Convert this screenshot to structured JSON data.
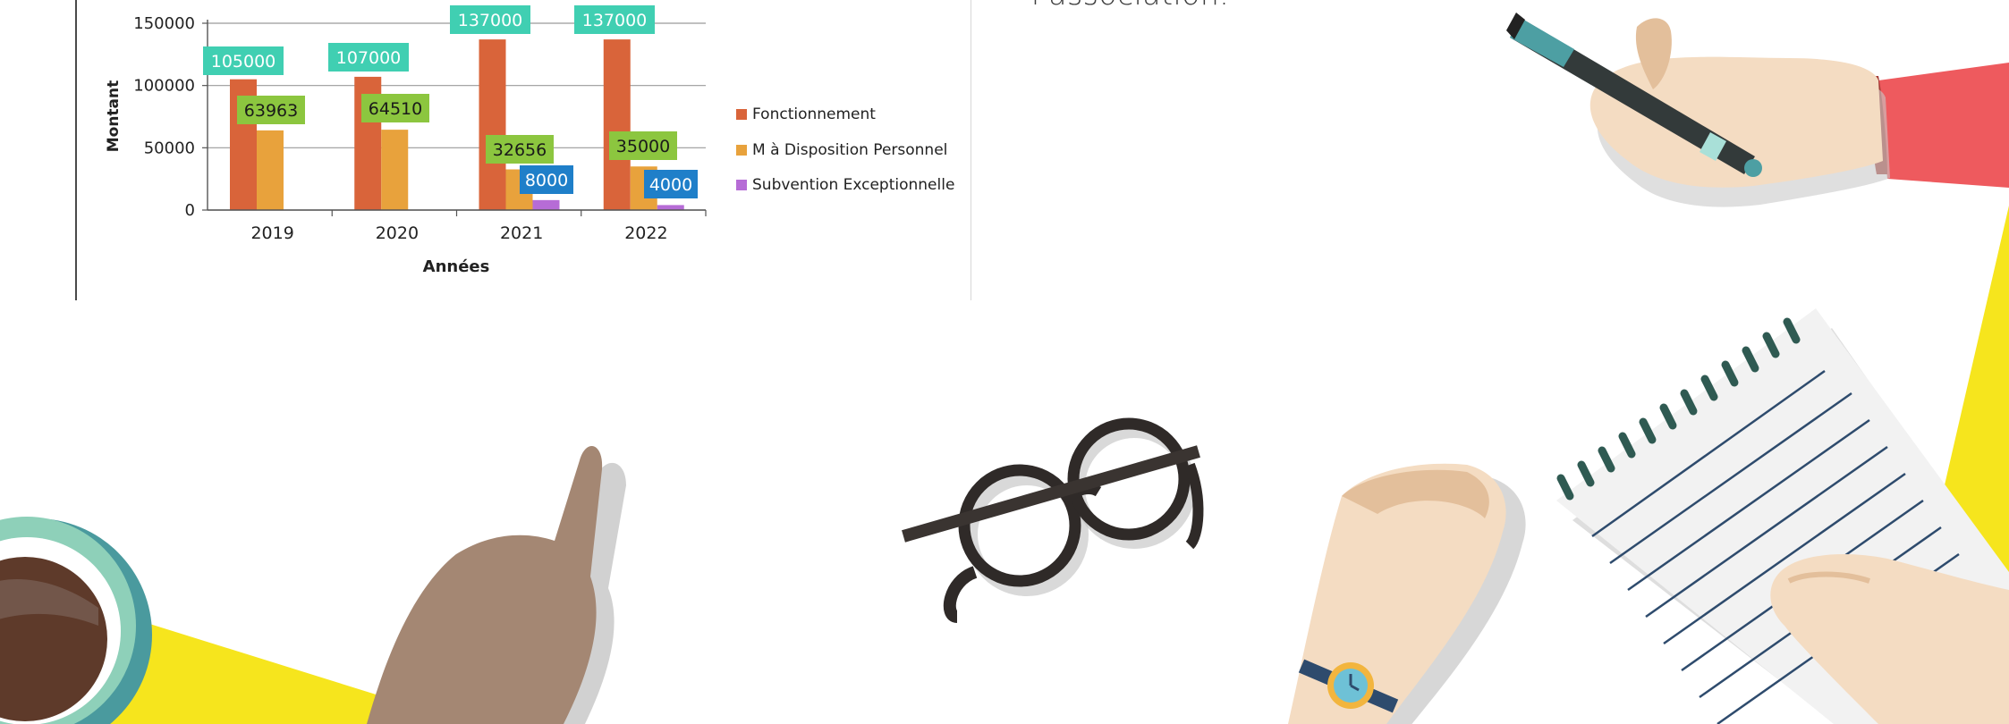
{
  "side_text": "l'association.",
  "colors": {
    "fonctionnement": "#d9643a",
    "mise_a_disposition": "#e8a23c",
    "subvention": "#b66cd6",
    "label_teal": "#40cfb2",
    "label_green": "#8cc63f",
    "label_blue": "#1f7fc9",
    "yellow": "#f6e51d",
    "skin": "#f4dcc2",
    "skin_dark": "#a48773"
  },
  "icons": [
    "pen-icon",
    "hand-with-pen-illustration",
    "pointing-hand-illustration",
    "coffee-cup-illustration",
    "glasses-illustration",
    "notebook-illustration",
    "watch-icon",
    "writing-hand-illustration"
  ],
  "chart_data": {
    "type": "bar",
    "title": "",
    "xlabel": "Années",
    "ylabel": "Montant",
    "categories": [
      "2019",
      "2020",
      "2021",
      "2022"
    ],
    "ylim": [
      0,
      150000
    ],
    "yticks": [
      "0",
      "50000",
      "100000",
      "150000"
    ],
    "grid": true,
    "legend_position": "right",
    "series": [
      {
        "name": "Fonctionnement",
        "values": [
          105000,
          107000,
          137000,
          137000
        ],
        "labels": [
          "105000",
          "107000",
          "137000",
          "137000"
        ]
      },
      {
        "name": "M à Disposition Personnel",
        "values": [
          63963,
          64510,
          32656,
          35000
        ],
        "labels": [
          "63963",
          "64510",
          "32656",
          "35000"
        ]
      },
      {
        "name": "Subvention Exceptionnelle",
        "values": [
          0,
          0,
          8000,
          4000
        ],
        "labels": [
          "",
          "",
          "8000",
          "4000"
        ]
      }
    ]
  }
}
